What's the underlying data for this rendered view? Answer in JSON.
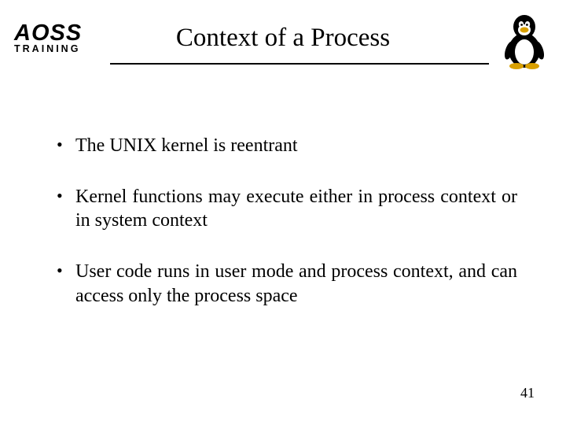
{
  "logo": {
    "main": "AOSS",
    "sub": "TRAINING"
  },
  "title": "Context of a Process",
  "bullets": [
    "The UNIX kernel is reentrant",
    "Kernel functions may execute either in process context or in system context",
    "User code runs in user mode and process context, and can access only the process space"
  ],
  "page_number": "41"
}
